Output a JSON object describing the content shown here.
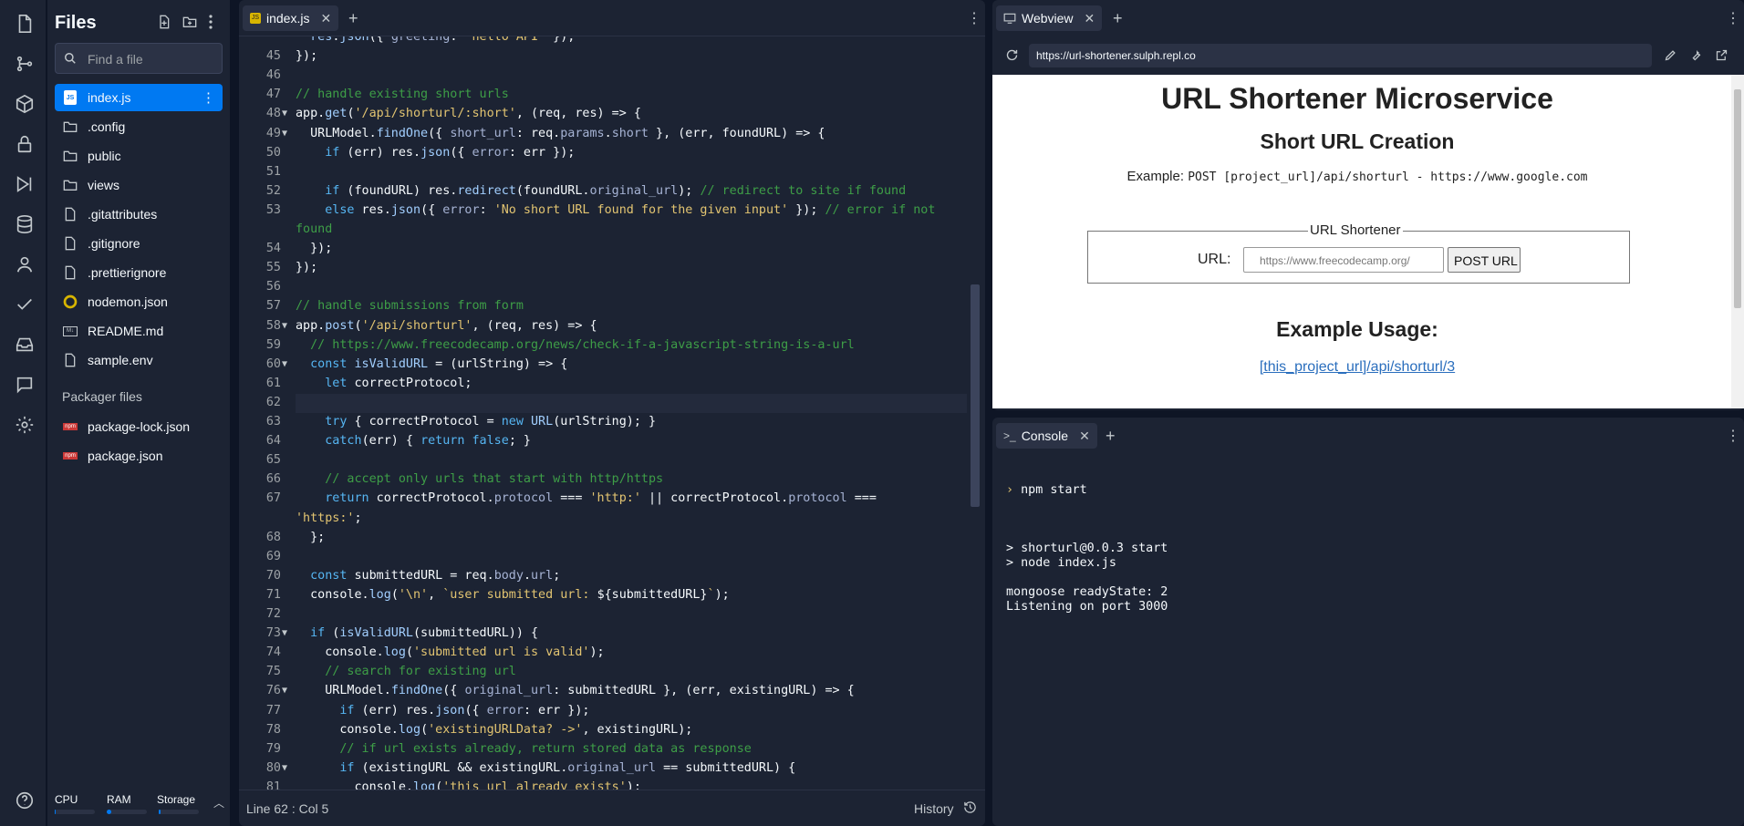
{
  "files": {
    "title": "Files",
    "search_placeholder": "Find a file",
    "items": [
      {
        "name": "index.js",
        "type": "js",
        "active": true
      },
      {
        "name": ".config",
        "type": "folder"
      },
      {
        "name": "public",
        "type": "folder"
      },
      {
        "name": "views",
        "type": "folder"
      },
      {
        "name": ".gitattributes",
        "type": "file"
      },
      {
        "name": ".gitignore",
        "type": "file"
      },
      {
        "name": ".prettierignore",
        "type": "file"
      },
      {
        "name": "nodemon.json",
        "type": "nodemon"
      },
      {
        "name": "README.md",
        "type": "md"
      },
      {
        "name": "sample.env",
        "type": "file"
      }
    ],
    "packager_label": "Packager files",
    "packager_items": [
      {
        "name": "package-lock.json"
      },
      {
        "name": "package.json"
      }
    ],
    "resources": {
      "cpu": "CPU",
      "ram": "RAM",
      "storage": "Storage",
      "cpu_level": 0.02,
      "ram_level": 0.12,
      "storage_level": 0.05
    }
  },
  "editor": {
    "tab_label": "index.js",
    "status": "Line 62 : Col 5",
    "history_label": "History"
  },
  "webview": {
    "tab_label": "Webview",
    "url": "https://url-shortener.sulph.repl.co",
    "h1": "URL Shortener Microservice",
    "h2": "Short URL Creation",
    "example_label": "Example:",
    "example_code": "POST [project_url]/api/shorturl - https://www.google.com",
    "legend": "URL Shortener",
    "url_label": "URL:",
    "url_placeholder": "https://www.freecodecamp.org/",
    "post_button": "POST URL",
    "usage_title": "Example Usage:",
    "usage_link": "[this_project_url]/api/shorturl/3"
  },
  "console": {
    "tab_label": "Console",
    "prompt": "›",
    "command": "npm start",
    "output": "> shorturl@0.0.3 start\n> node index.js\n\nmongoose readyState: 2\nListening on port 3000"
  },
  "code_lines": [
    {
      "n": "",
      "html": "  <span class=\"f\">res</span>.<span class=\"f\">json</span>({ <span class=\"p\">greeting</span>: <span class=\"s\">'hello API'</span> });"
    },
    {
      "n": "45",
      "html": "});"
    },
    {
      "n": "46",
      "html": ""
    },
    {
      "n": "47",
      "html": "<span class=\"c\">// handle existing short urls</span>"
    },
    {
      "n": "48",
      "fold": true,
      "html": "app.<span class=\"f\">get</span>(<span class=\"s\">'/api/shorturl/:short'</span>, (req, res) => {"
    },
    {
      "n": "49",
      "fold": true,
      "html": "  URLModel.<span class=\"f\">findOne</span>({ <span class=\"p\">short_url</span>: req.<span class=\"p\">params</span>.<span class=\"p\">short</span> }, (err, foundURL) => {"
    },
    {
      "n": "50",
      "html": "    <span class=\"k\">if</span> (err) res.<span class=\"f\">json</span>({ <span class=\"p\">error</span>: err });"
    },
    {
      "n": "51",
      "html": ""
    },
    {
      "n": "52",
      "html": "    <span class=\"k\">if</span> (foundURL) res.<span class=\"f\">redirect</span>(foundURL.<span class=\"p\">original_url</span>); <span class=\"c\">// redirect to site if found</span>"
    },
    {
      "n": "53",
      "html": "    <span class=\"k\">else</span> res.<span class=\"f\">json</span>({ <span class=\"p\">error</span>: <span class=\"s\">'No short URL found for the given input'</span> }); <span class=\"c\">// error if not</span>"
    },
    {
      "n": "",
      "html": "<span class=\"c\">found</span>"
    },
    {
      "n": "54",
      "html": "  });"
    },
    {
      "n": "55",
      "html": "});"
    },
    {
      "n": "56",
      "html": ""
    },
    {
      "n": "57",
      "html": "<span class=\"c\">// handle submissions from form</span>"
    },
    {
      "n": "58",
      "fold": true,
      "html": "app.<span class=\"f\">post</span>(<span class=\"s\">'/api/shorturl'</span>, (req, res) => {"
    },
    {
      "n": "59",
      "html": "  <span class=\"c\">// https://www.freecodecamp.org/news/check-if-a-javascript-string-is-a-url</span>"
    },
    {
      "n": "60",
      "fold": true,
      "html": "  <span class=\"k\">const</span> <span class=\"f\">isValidURL</span> = (urlString) => {"
    },
    {
      "n": "61",
      "html": "    <span class=\"k\">let</span> correctProtocol;"
    },
    {
      "n": "62",
      "html": ""
    },
    {
      "n": "63",
      "html": "    <span class=\"k\">try</span> { correctProtocol = <span class=\"k\">new</span> <span class=\"f\">URL</span>(urlString); }"
    },
    {
      "n": "64",
      "html": "    <span class=\"k\">catch</span>(err) { <span class=\"k\">return</span> <span class=\"k\">false</span>; }"
    },
    {
      "n": "65",
      "html": ""
    },
    {
      "n": "66",
      "html": "    <span class=\"c\">// accept only urls that start with http/https</span>"
    },
    {
      "n": "67",
      "html": "    <span class=\"k\">return</span> correctProtocol.<span class=\"p\">protocol</span> === <span class=\"s\">'http:'</span> || correctProtocol.<span class=\"p\">protocol</span> ==="
    },
    {
      "n": "",
      "html": "<span class=\"s\">'https:'</span>;"
    },
    {
      "n": "68",
      "html": "  };"
    },
    {
      "n": "69",
      "html": ""
    },
    {
      "n": "70",
      "html": "  <span class=\"k\">const</span> submittedURL = req.<span class=\"p\">body</span>.<span class=\"p\">url</span>;"
    },
    {
      "n": "71",
      "html": "  console.<span class=\"f\">log</span>(<span class=\"s\">'\\n'</span>, <span class=\"s\">`user submitted url: </span>${submittedURL}<span class=\"s\">`</span>);"
    },
    {
      "n": "72",
      "html": ""
    },
    {
      "n": "73",
      "fold": true,
      "html": "  <span class=\"k\">if</span> (<span class=\"f\">isValidURL</span>(submittedURL)) {"
    },
    {
      "n": "74",
      "html": "    console.<span class=\"f\">log</span>(<span class=\"s\">'submitted url is valid'</span>);"
    },
    {
      "n": "75",
      "html": "    <span class=\"c\">// search for existing url</span>"
    },
    {
      "n": "76",
      "fold": true,
      "html": "    URLModel.<span class=\"f\">findOne</span>({ <span class=\"p\">original_url</span>: submittedURL }, (err, existingURL) => {"
    },
    {
      "n": "77",
      "html": "      <span class=\"k\">if</span> (err) res.<span class=\"f\">json</span>({ <span class=\"p\">error</span>: err });"
    },
    {
      "n": "78",
      "html": "      console.<span class=\"f\">log</span>(<span class=\"s\">'existingURLData? ->'</span>, existingURL);"
    },
    {
      "n": "79",
      "html": "      <span class=\"c\">// if url exists already, return stored data as response</span>"
    },
    {
      "n": "80",
      "fold": true,
      "html": "      <span class=\"k\">if</span> (existingURL && existingURL.<span class=\"p\">original_url</span> == submittedURL) {"
    },
    {
      "n": "81",
      "html": "        console.<span class=\"f\">log</span>(<span class=\"s\">'this url already exists'</span>);"
    }
  ]
}
